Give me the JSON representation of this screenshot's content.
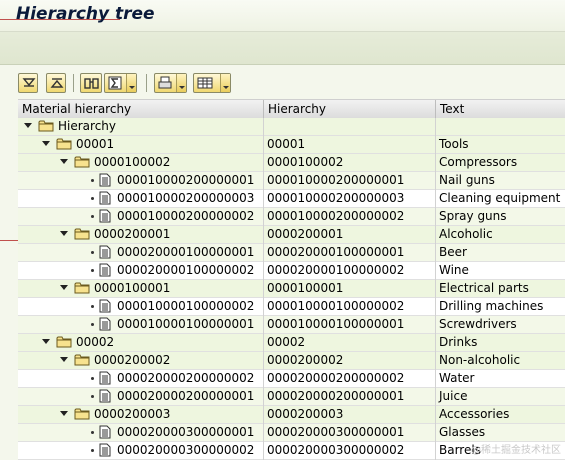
{
  "window": {
    "title": "Hierarchy tree"
  },
  "toolbar": {
    "buttons": [
      {
        "icon": "expand-all-icon"
      },
      {
        "icon": "collapse-all-icon"
      },
      {
        "icon": "find-icon"
      },
      {
        "icon": "sum-icon"
      },
      {
        "icon": "print-icon"
      },
      {
        "icon": "layout-icon"
      }
    ]
  },
  "grid": {
    "columns": [
      "Material hierarchy",
      "Hierarchy",
      "Text"
    ],
    "rows": [
      {
        "level": 0,
        "type": "folder",
        "expanded": true,
        "label": "Hierarchy",
        "hierarchy": "",
        "text": ""
      },
      {
        "level": 1,
        "type": "folder",
        "expanded": true,
        "label": "00001",
        "hierarchy": "00001",
        "text": "Tools"
      },
      {
        "level": 2,
        "type": "folder",
        "expanded": true,
        "label": "0000100002",
        "hierarchy": "0000100002",
        "text": "Compressors"
      },
      {
        "level": 3,
        "type": "doc",
        "label": "000010000200000001",
        "hierarchy": "000010000200000001",
        "text": "Nail guns"
      },
      {
        "level": 3,
        "type": "doc",
        "label": "000010000200000003",
        "hierarchy": "000010000200000003",
        "text": "Cleaning equipment"
      },
      {
        "level": 3,
        "type": "doc",
        "label": "000010000200000002",
        "hierarchy": "000010000200000002",
        "text": "Spray guns"
      },
      {
        "level": 2,
        "type": "folder",
        "expanded": true,
        "label": "0000200001",
        "hierarchy": "0000200001",
        "text": "Alcoholic"
      },
      {
        "level": 3,
        "type": "doc",
        "label": "000020000100000001",
        "hierarchy": "000020000100000001",
        "text": "Beer"
      },
      {
        "level": 3,
        "type": "doc",
        "label": "000020000100000002",
        "hierarchy": "000020000100000002",
        "text": "Wine"
      },
      {
        "level": 2,
        "type": "folder",
        "expanded": true,
        "label": "0000100001",
        "hierarchy": "0000100001",
        "text": "Electrical parts"
      },
      {
        "level": 3,
        "type": "doc",
        "label": "000010000100000002",
        "hierarchy": "000010000100000002",
        "text": "Drilling machines"
      },
      {
        "level": 3,
        "type": "doc",
        "label": "000010000100000001",
        "hierarchy": "000010000100000001",
        "text": "Screwdrivers"
      },
      {
        "level": 1,
        "type": "folder",
        "expanded": true,
        "label": "00002",
        "hierarchy": "00002",
        "text": "Drinks"
      },
      {
        "level": 2,
        "type": "folder",
        "expanded": true,
        "label": "0000200002",
        "hierarchy": "0000200002",
        "text": "Non-alcoholic"
      },
      {
        "level": 3,
        "type": "doc",
        "label": "000020000200000002",
        "hierarchy": "000020000200000002",
        "text": "Water"
      },
      {
        "level": 3,
        "type": "doc",
        "label": "000020000200000001",
        "hierarchy": "000020000200000001",
        "text": "Juice"
      },
      {
        "level": 2,
        "type": "folder",
        "expanded": true,
        "label": "0000200003",
        "hierarchy": "0000200003",
        "text": "Accessories"
      },
      {
        "level": 3,
        "type": "doc",
        "label": "000020000300000001",
        "hierarchy": "000020000300000001",
        "text": "Glasses"
      },
      {
        "level": 3,
        "type": "doc",
        "label": "000020000300000002",
        "hierarchy": "000020000300000002",
        "text": "Barrels"
      }
    ]
  },
  "watermark": "@稀土掘金技术社区"
}
